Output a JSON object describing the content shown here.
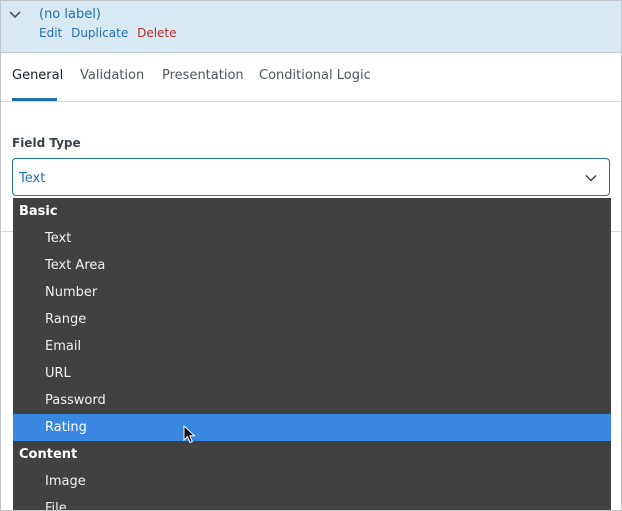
{
  "field": {
    "label": "(no label)",
    "actions": {
      "edit": "Edit",
      "duplicate": "Duplicate",
      "delete": "Delete"
    }
  },
  "tabs": [
    {
      "label": "General",
      "active": true
    },
    {
      "label": "Validation",
      "active": false
    },
    {
      "label": "Presentation",
      "active": false
    },
    {
      "label": "Conditional Logic",
      "active": false
    }
  ],
  "field_type": {
    "label": "Field Type",
    "selected": "Text"
  },
  "dropdown": {
    "groups": [
      {
        "label": "Basic",
        "options": [
          "Text",
          "Text Area",
          "Number",
          "Range",
          "Email",
          "URL",
          "Password",
          "Rating"
        ]
      },
      {
        "label": "Content",
        "options": [
          "Image",
          "File"
        ]
      }
    ],
    "highlighted": "Rating"
  },
  "colors": {
    "accent": "#2271b1",
    "delete": "#b32d2e",
    "header_bg": "#d9e9f3",
    "dropdown_bg": "#414141",
    "highlight": "#3a87e0"
  }
}
